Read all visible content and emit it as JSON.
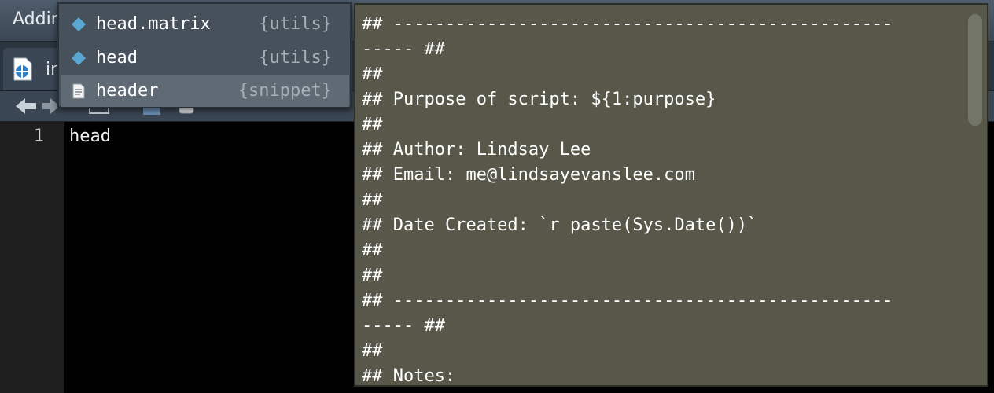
{
  "window": {
    "menu_title": "Addin",
    "tab_label": "in"
  },
  "editor": {
    "line_number": "1",
    "line_text": "head"
  },
  "autocomplete": {
    "items": [
      {
        "name": "head.matrix",
        "source": "{utils}",
        "icon": "function-diamond-icon",
        "selected": false
      },
      {
        "name": "head",
        "source": "{utils}",
        "icon": "function-diamond-icon",
        "selected": false
      },
      {
        "name": "header",
        "source": "{snippet}",
        "icon": "snippet-document-icon",
        "selected": true
      }
    ]
  },
  "preview": {
    "lines": [
      "## ------------------------------------------------",
      "----- ##",
      "##",
      "## Purpose of script: ${1:purpose}",
      "##",
      "## Author: Lindsay Lee",
      "## Email: me@lindsayevanslee.com",
      "##",
      "## Date Created: `r paste(Sys.Date())`",
      "##",
      "##",
      "## ------------------------------------------------",
      "----- ##",
      "##",
      "## Notes:"
    ]
  },
  "colors": {
    "preview_bg": "#57574a",
    "popup_bg": "#46515c",
    "selected_bg": "#5f6a74",
    "function_icon": "#5aa7d4",
    "editor_bg": "#000000"
  }
}
